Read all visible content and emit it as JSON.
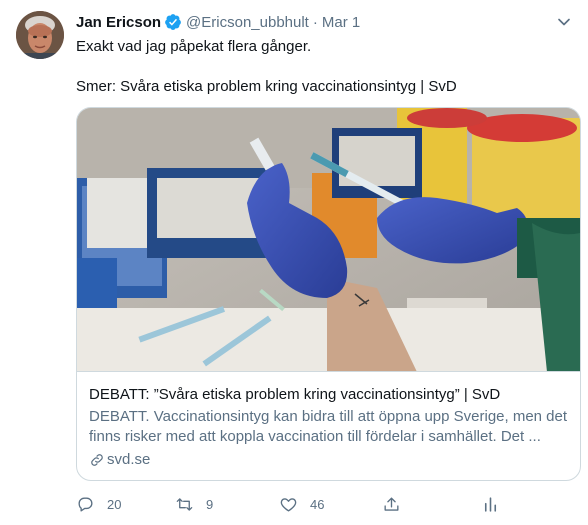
{
  "tweet": {
    "author_name": "Jan Ericson",
    "handle": "@Ericson_ubbhult",
    "separator": "·",
    "date": "Mar 1",
    "text_line1": "Exakt vad jag påpekat flera gånger.",
    "text_line2": "Smer: Svåra etiska problem kring vaccinationsintyg | SvD",
    "verified": true
  },
  "card": {
    "title": "DEBATT: ”Svåra etiska problem kring vaccinationsintyg” | SvD",
    "description": "DEBATT. Vaccinationsintyg kan bidra till att öppna upp Sverige, men det finns risker med att koppla vaccination till fördelar i samhället. Det ...",
    "domain": "svd.se"
  },
  "actions": {
    "reply_count": "20",
    "retweet_count": "9",
    "like_count": "46",
    "share_count": "",
    "icons": [
      "reply-icon",
      "retweet-icon",
      "like-icon",
      "share-icon",
      "analytics-icon"
    ]
  },
  "colors": {
    "text_primary": "#0f1419",
    "text_secondary": "#5b7083",
    "verified_blue": "#1da1f2",
    "border": "#cfd9de"
  }
}
